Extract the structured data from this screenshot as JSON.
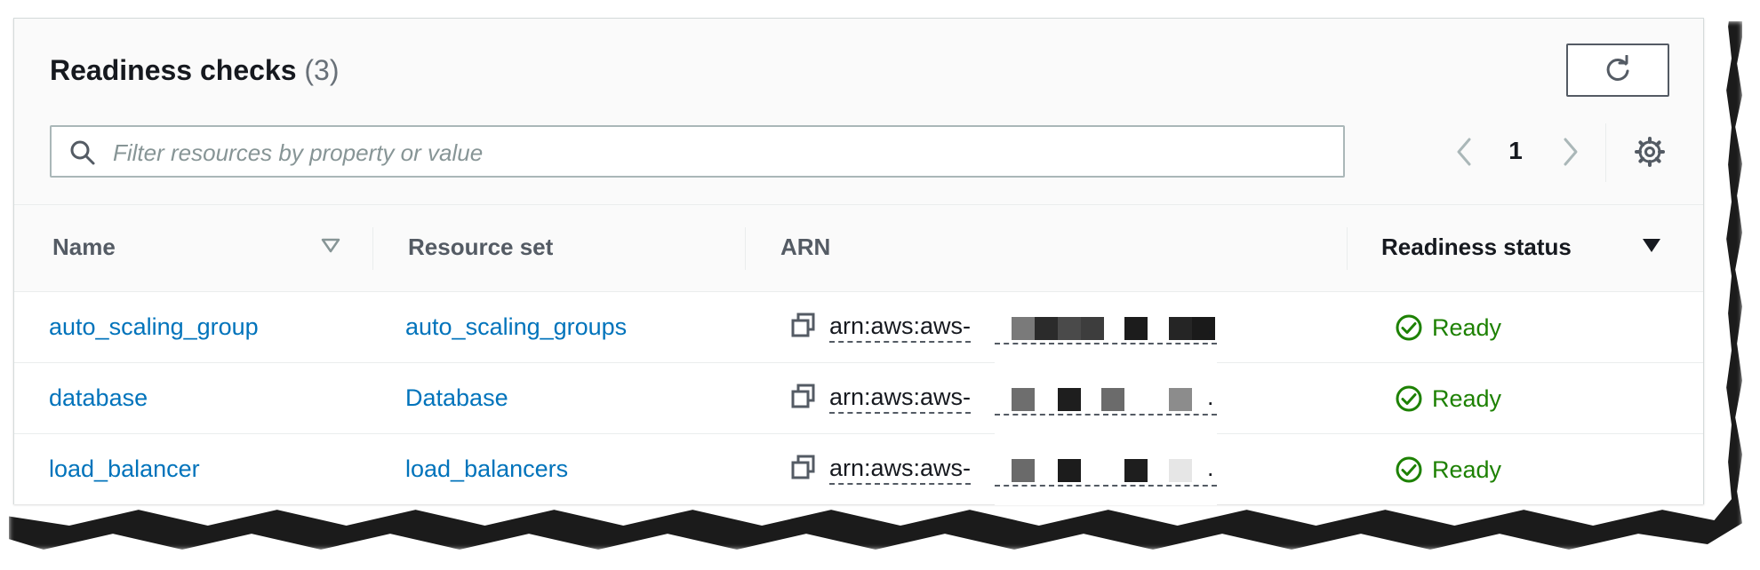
{
  "header": {
    "title": "Readiness checks",
    "count": "(3)"
  },
  "search": {
    "placeholder": "Filter resources by property or value"
  },
  "pagination": {
    "current_page": "1"
  },
  "table": {
    "columns": [
      "Name",
      "Resource set",
      "ARN",
      "Readiness status"
    ],
    "rows": [
      {
        "name": "auto_scaling_group",
        "resource_set": "auto_scaling_groups",
        "arn": "arn:aws:aws-",
        "arn_suffix": ".",
        "status": "Ready"
      },
      {
        "name": "database",
        "resource_set": "Database",
        "arn": "arn:aws:aws-",
        "arn_suffix": ".",
        "status": "Ready"
      },
      {
        "name": "load_balancer",
        "resource_set": "load_balancers",
        "arn": "arn:aws:aws-",
        "arn_suffix": ".",
        "status": "Ready"
      }
    ]
  },
  "icons": {
    "refresh": "refresh-icon",
    "search": "search-icon",
    "prev": "chevron-left-icon",
    "next": "chevron-right-icon",
    "settings": "gear-icon",
    "sort_name": "sort-caret-outline-icon",
    "sort_status": "sort-caret-filled-icon",
    "copy": "copy-icon",
    "status": "check-circle-icon"
  },
  "colors": {
    "link": "#0073bb",
    "success": "#1d8102",
    "text": "#16191f",
    "muted": "#545b64"
  }
}
